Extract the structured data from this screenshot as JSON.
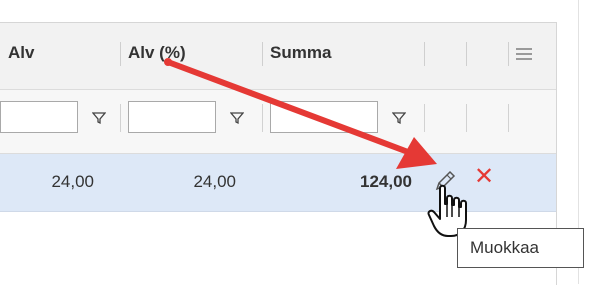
{
  "columns": {
    "alv": "Alv",
    "alv_pct": "Alv (%)",
    "summa": "Summa"
  },
  "row": {
    "alv": "24,00",
    "alv_pct": "24,00",
    "summa": "124,00"
  },
  "tooltip": "Muokkaa",
  "icons": {
    "menu": "hamburger-menu-icon",
    "filter": "funnel-icon",
    "edit": "pencil-icon",
    "delete": "close-icon",
    "cursor": "hand-pointer-icon"
  },
  "colors": {
    "annotation_arrow": "#e53935",
    "selected_row": "#dde8f7",
    "delete": "#e53935"
  }
}
